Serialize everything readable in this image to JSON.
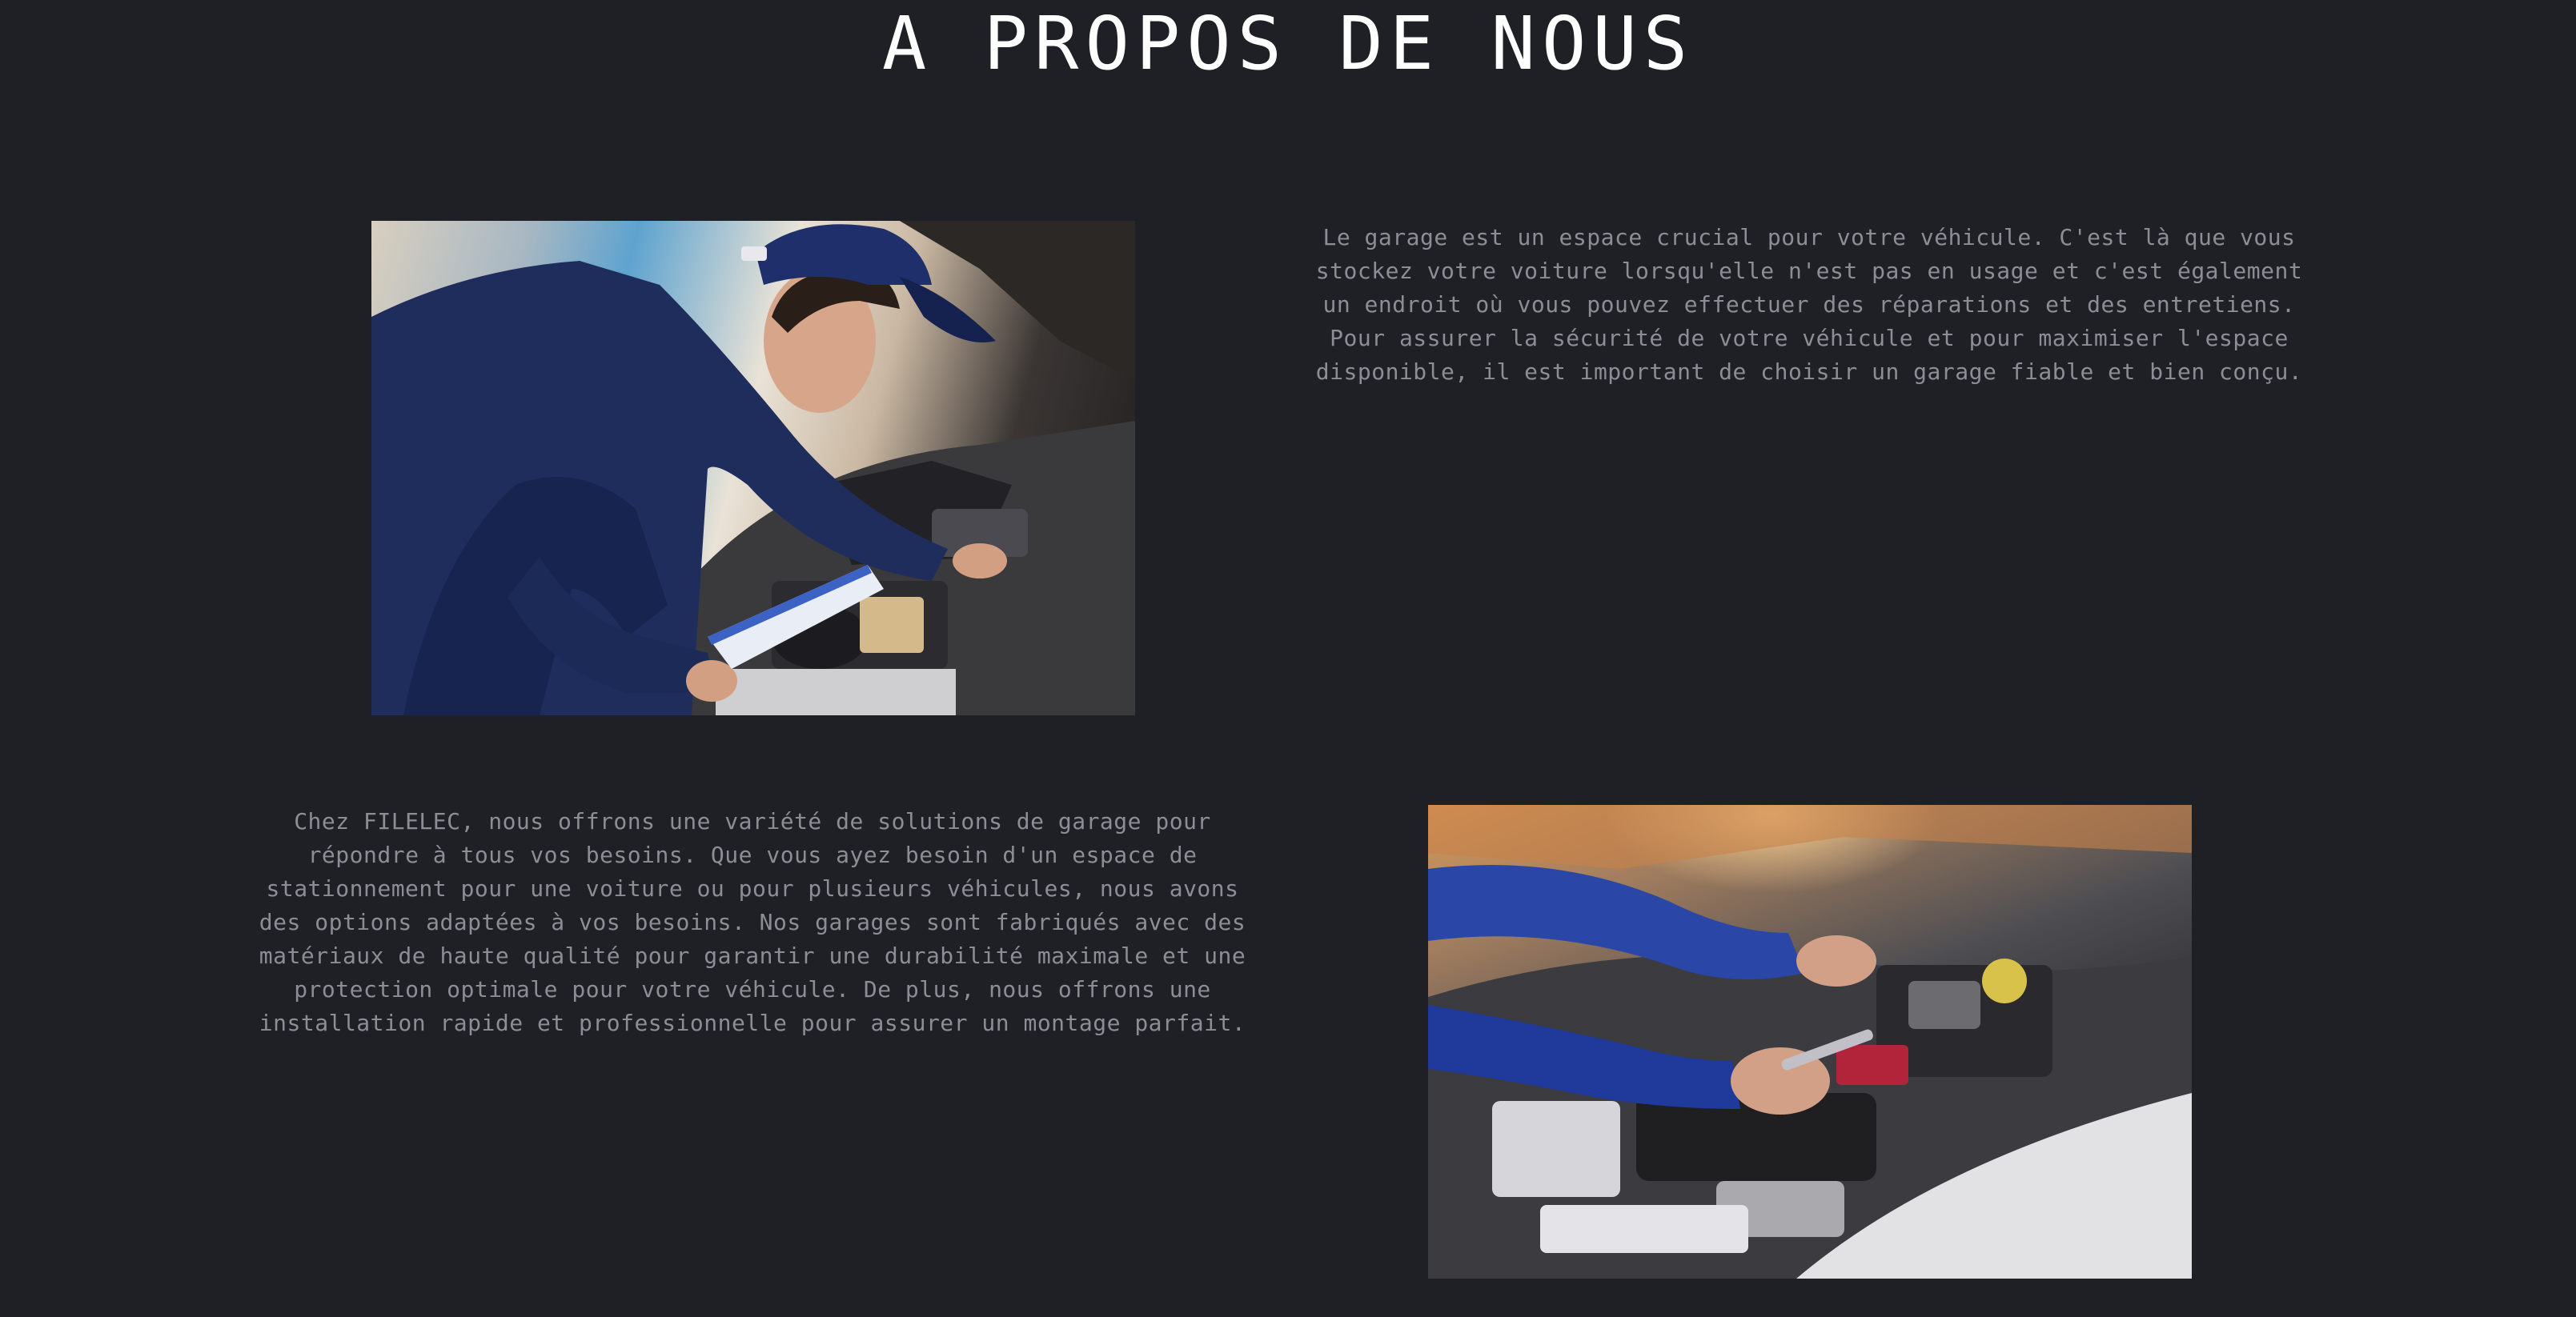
{
  "page": {
    "title": "A PROPOS DE NOUS"
  },
  "sections": [
    {
      "text": "Le garage est un espace crucial pour votre véhicule. C'est là que vous stockez votre voiture lorsqu'elle n'est pas en usage et c'est également un endroit où vous pouvez effectuer des réparations et des entretiens. Pour assurer la sécurité de votre véhicule et pour maximiser l'espace disponible, il est important de choisir un garage fiable et bien conçu.",
      "image": "mechanic-with-clipboard-photo"
    },
    {
      "text": "Chez FILELEC, nous offrons une variété de solutions de garage pour répondre à tous vos besoins. Que vous ayez besoin d'un espace de stationnement pour une voiture ou pour plusieurs véhicules, nous avons des options adaptées à vos besoins. Nos garages sont fabriqués avec des matériaux de haute qualité pour garantir une durabilité maximale et une protection optimale pour votre véhicule. De plus, nous offrons une installation rapide et professionnelle pour assurer un montage parfait.",
      "image": "hands-working-on-engine-photo"
    }
  ],
  "colors": {
    "background": "#1f1f26",
    "title": "#ffffff",
    "body_text": "#8d8d96"
  }
}
